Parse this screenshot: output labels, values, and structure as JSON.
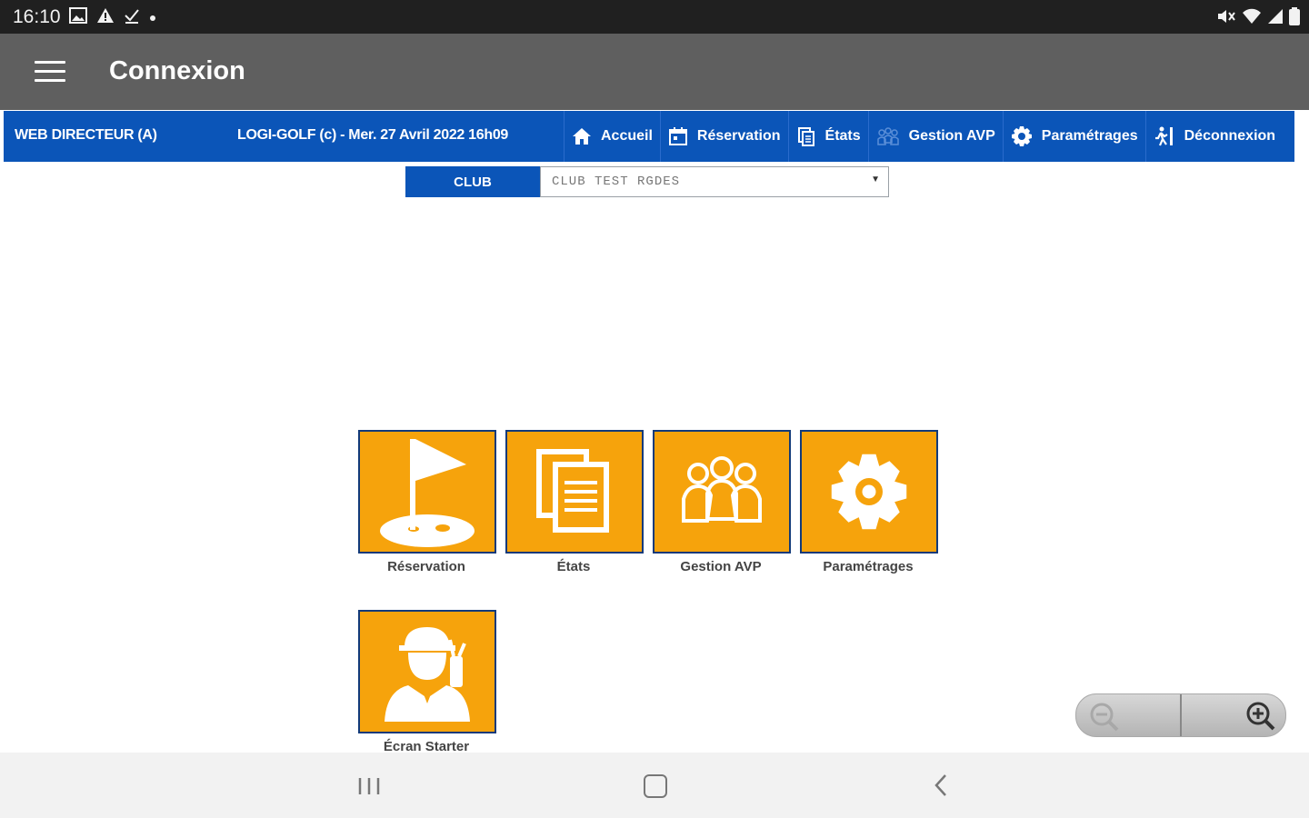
{
  "status_bar": {
    "time": "16:10",
    "left_icons": [
      "image-icon",
      "warning-icon",
      "download-done-icon",
      "dot-icon"
    ],
    "right_icons": [
      "mute-icon",
      "wifi-icon",
      "signal-icon",
      "battery-icon"
    ]
  },
  "app_bar": {
    "title": "Connexion",
    "menu_icon": "menu-icon"
  },
  "nav": {
    "user_label": "WEB DIRECTEUR (A)",
    "info_label": "LOGI-GOLF (c) - Mer. 27 Avril 2022 16h09",
    "items": [
      {
        "label": "Accueil",
        "icon": "home-icon"
      },
      {
        "label": "Réservation",
        "icon": "calendar-icon"
      },
      {
        "label": "États",
        "icon": "documents-icon"
      },
      {
        "label": "Gestion AVP",
        "icon": "people-icon"
      },
      {
        "label": "Paramétrages",
        "icon": "gear-icon"
      },
      {
        "label": "Déconnexion",
        "icon": "exit-icon"
      }
    ],
    "accent": "#0b55b8"
  },
  "club_selector": {
    "label": "CLUB",
    "value": "CLUB TEST RGDES"
  },
  "tiles": [
    {
      "label": "Réservation",
      "icon": "golf-flag-icon"
    },
    {
      "label": "États",
      "icon": "documents-icon"
    },
    {
      "label": "Gestion AVP",
      "icon": "people-icon"
    },
    {
      "label": "Paramétrages",
      "icon": "gear-icon"
    },
    {
      "label": "Écran Starter",
      "icon": "golfer-icon"
    }
  ],
  "tile_color": "#f6a30c",
  "zoom": {
    "out_icon": "zoom-out-icon",
    "in_icon": "zoom-in-icon"
  },
  "system_nav": {
    "recents": "recents-icon",
    "home": "home-circle-icon",
    "back": "back-icon"
  }
}
